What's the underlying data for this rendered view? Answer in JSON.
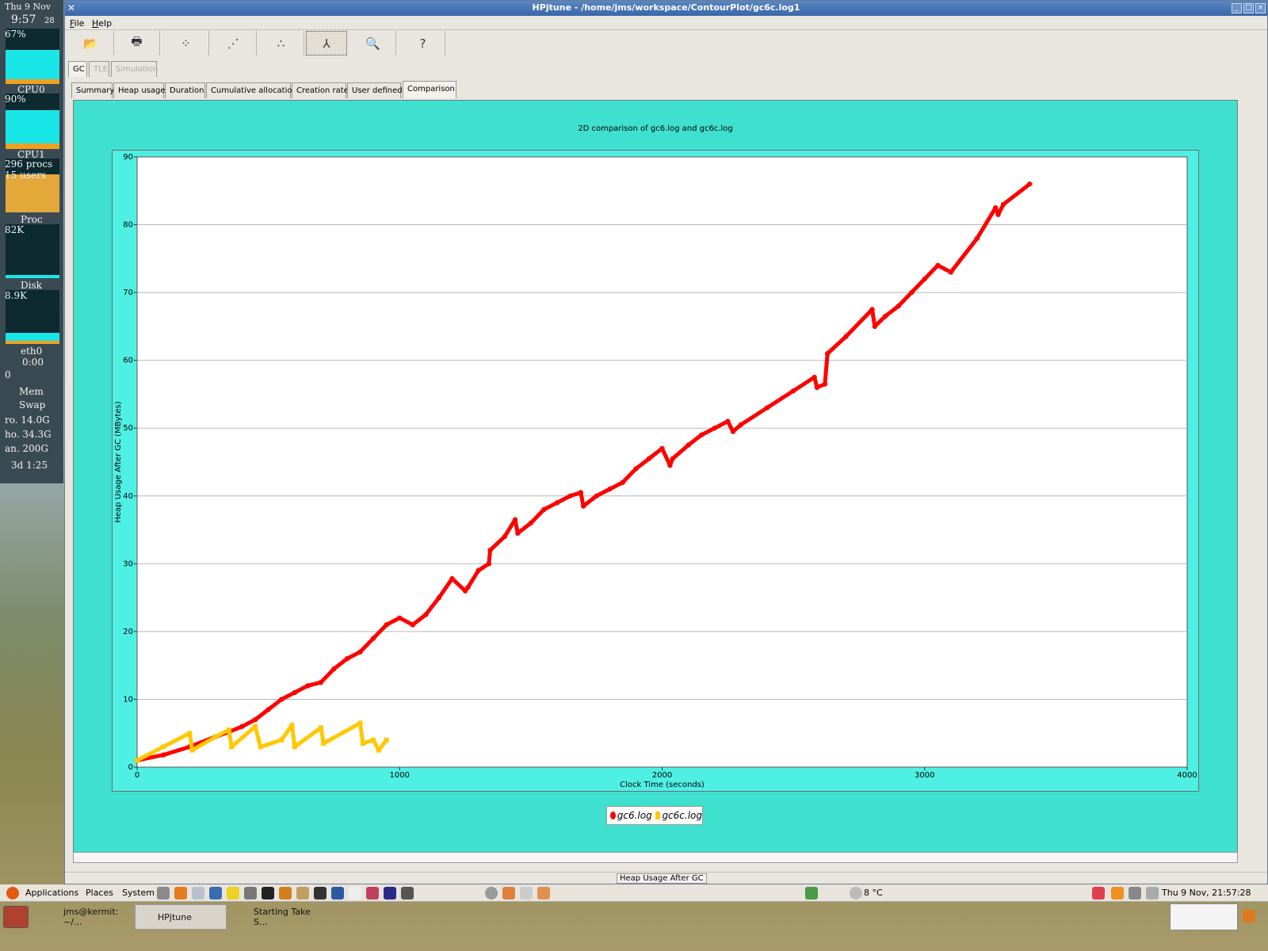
{
  "monitor": {
    "date": "Thu  9  Nov",
    "time": "9:57",
    "seconds": "28",
    "cpu_pct": "67%",
    "cpu0_label": "CPU0",
    "cpu0_pct": "90%",
    "cpu1_label": "CPU1",
    "procs": "296 procs",
    "users": "15 users",
    "proc_label": "Proc",
    "proc_val": "82K",
    "disk_label": "Disk",
    "disk_val": "8.9K",
    "net_label": "eth0",
    "net_val": "0:00",
    "net_zero": "0",
    "mem_label": "Mem",
    "swap_label": "Swap",
    "fs1": "ro. 14.0G",
    "fs2": "ho. 34.3G",
    "fs3": "an. 200G",
    "uptime": "3d  1:25"
  },
  "window": {
    "title": "HPjtune - /home/jms/workspace/ContourPlot/gc6c.log1",
    "menus": [
      "File",
      "Help"
    ],
    "top_tabs": [
      {
        "label": "GC",
        "state": "selected"
      },
      {
        "label": "TLE",
        "state": "disabled"
      },
      {
        "label": "Simulation",
        "state": "disabled"
      }
    ],
    "sub_tabs": [
      "Summary",
      "Heap usage",
      "Duration",
      "Cumulative allocation",
      "Creation rate",
      "User defined",
      "Comparison"
    ],
    "selected_sub_tab": "Comparison",
    "status_label": "Heap Usage After GC"
  },
  "toolbar": {
    "icons": [
      "open-folder-icon",
      "print-icon",
      "scatter-plot-icon",
      "connected-points-icon",
      "points-icon",
      "axes-icon",
      "zoom-icon",
      "help-icon"
    ]
  },
  "chart_data": {
    "type": "line",
    "title": "2D comparison of gc6.log and gc6c.log",
    "xlabel": "Clock Time  (seconds)",
    "ylabel": "Heap Usage After GC  (MBytes)",
    "xlim": [
      0,
      4000
    ],
    "ylim": [
      0,
      90
    ],
    "x_ticks": [
      0,
      1000,
      2000,
      3000,
      4000
    ],
    "y_ticks": [
      0,
      10,
      20,
      30,
      40,
      50,
      60,
      70,
      80,
      90
    ],
    "grid": "horizontal",
    "legend_position": "bottom-center",
    "series": [
      {
        "name": "gc6.log",
        "color": "#ff0000",
        "marker": "circle",
        "x": [
          0,
          100,
          200,
          300,
          350,
          400,
          450,
          500,
          550,
          600,
          650,
          700,
          750,
          800,
          850,
          900,
          950,
          1000,
          1050,
          1100,
          1150,
          1200,
          1250,
          1260,
          1300,
          1340,
          1345,
          1400,
          1440,
          1450,
          1500,
          1550,
          1600,
          1650,
          1690,
          1700,
          1750,
          1800,
          1850,
          1900,
          1950,
          2000,
          2030,
          2040,
          2100,
          2150,
          2200,
          2250,
          2270,
          2300,
          2400,
          2500,
          2580,
          2590,
          2620,
          2630,
          2700,
          2800,
          2810,
          2850,
          2900,
          2950,
          3000,
          3050,
          3100,
          3200,
          3270,
          3280,
          3300,
          3400
        ],
        "y": [
          1,
          1.8,
          3,
          4.5,
          5.2,
          6,
          7,
          8.5,
          10,
          11,
          12,
          12.5,
          14.5,
          16,
          17,
          19,
          21,
          22,
          21,
          22.5,
          25,
          27.8,
          26,
          26.5,
          29,
          30,
          32,
          34,
          36.5,
          34.5,
          36,
          38,
          39,
          40,
          40.5,
          38.5,
          40,
          41,
          42,
          44,
          45.5,
          47,
          44.5,
          45.5,
          47.5,
          49,
          50,
          51,
          49.5,
          50.5,
          53,
          55.5,
          57.5,
          56,
          56.5,
          61,
          63.5,
          67.5,
          65,
          66.5,
          68,
          70,
          72,
          74,
          73,
          78,
          82.5,
          81.5,
          83,
          86
        ]
      },
      {
        "name": "gc6c.log",
        "color": "#ffc800",
        "marker": "square",
        "x": [
          0,
          100,
          200,
          210,
          300,
          350,
          360,
          450,
          470,
          550,
          590,
          600,
          700,
          710,
          850,
          860,
          900,
          920,
          950
        ],
        "y": [
          1,
          3,
          5,
          2.5,
          4.5,
          5.5,
          3,
          6,
          3,
          4,
          6.2,
          3,
          5.8,
          3.5,
          6.5,
          3.5,
          4,
          2.5,
          4
        ]
      }
    ]
  },
  "taskbar": {
    "menus": [
      "Applications",
      "Places",
      "System"
    ],
    "weather": "8 °C",
    "clock": "Thu  9 Nov, 21:57:28",
    "tasks": [
      {
        "label": "jms@kermit: ~/...",
        "active": false
      },
      {
        "label": "HPjtune",
        "active": true
      },
      {
        "label": "Starting Take S...",
        "active": false
      }
    ]
  }
}
